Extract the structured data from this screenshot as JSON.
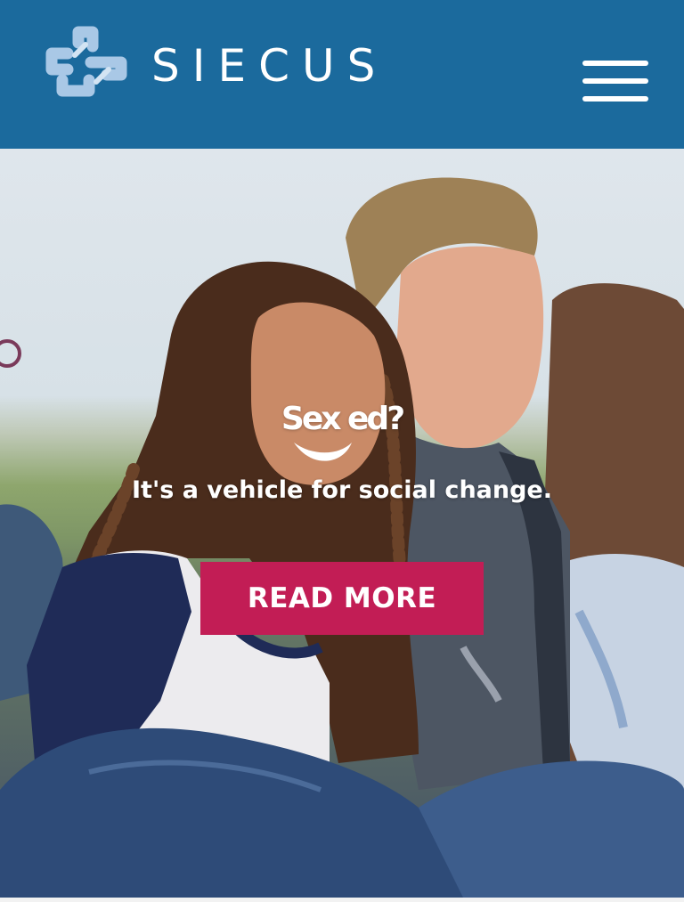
{
  "header": {
    "brand": "SIECUS",
    "background_color": "#1b6a9d",
    "logo_icon": "siecus-knot-logo-icon",
    "menu_icon": "hamburger-menu-icon"
  },
  "hero": {
    "headline": "Sex ed?",
    "tagline": "It's a vehicle for social change.",
    "cta_label": "READ MORE",
    "cta_color": "#c21d55"
  }
}
